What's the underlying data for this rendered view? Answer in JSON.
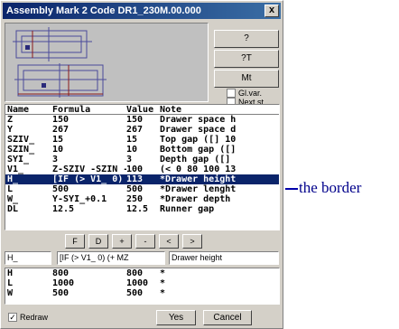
{
  "window": {
    "title": "Assembly Mark 2 Code DR1_230M.00.000",
    "close_label": "x"
  },
  "side_buttons": [
    "?",
    "?T",
    "Mt"
  ],
  "checkboxes": [
    {
      "label": "Gl.var.",
      "checked": false
    },
    {
      "label": "Next st.",
      "checked": false
    }
  ],
  "table": {
    "headers": [
      "Name",
      "Formula",
      "Value",
      "Note"
    ],
    "rows": [
      [
        "Z",
        "150",
        "150",
        "Drawer space h"
      ],
      [
        "Y",
        "267",
        "267",
        "Drawer space d"
      ],
      [
        "SZIV_",
        "15",
        "15",
        "Top gap ([] 10"
      ],
      [
        "SZIN_",
        "10",
        "10",
        "Bottom gap ([]"
      ],
      [
        "SYI_",
        "3",
        "3",
        "Depth gap ([]"
      ],
      [
        "V1_",
        "Z-SZIV -SZIN -",
        "100",
        "(< 0 80 100 13"
      ],
      [
        "H_",
        "[IF (> V1_ 0)",
        "113",
        "*Drawer height"
      ],
      [
        "L",
        "500",
        "500",
        "*Drawer lenght"
      ],
      [
        "W_",
        "Y-SYI_+0.1",
        "250",
        "*Drawer depth"
      ],
      [
        "DL",
        "12.5",
        "12.5",
        "Runner gap"
      ]
    ]
  },
  "tool_buttons": [
    "F",
    "D",
    "+",
    "-",
    "<",
    ">"
  ],
  "edit": {
    "name": "H_",
    "formula": "[IF (> V1_ 0) (+ MZ",
    "note": "Drawer height"
  },
  "table2": {
    "rows": [
      [
        "H",
        "800",
        "800",
        "*"
      ],
      [
        "L",
        "1000",
        "1000",
        "*"
      ],
      [
        "W",
        "500",
        "500",
        "*"
      ]
    ]
  },
  "footer": {
    "redraw_label": "Redraw",
    "redraw_checked": true,
    "yes_label": "Yes",
    "cancel_label": "Cancel"
  },
  "annotation": {
    "text": "the border"
  },
  "colors": {
    "selection": "#0a246a",
    "annotation": "#00008b"
  }
}
